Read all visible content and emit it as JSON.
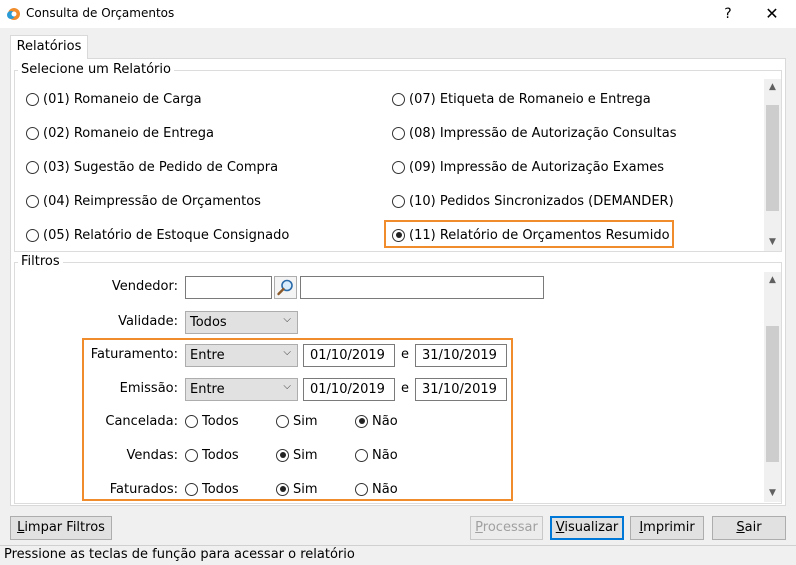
{
  "window": {
    "title": "Consulta de Orçamentos",
    "help_symbol": "?",
    "close_symbol": "✕",
    "icon": "app-logo-icon"
  },
  "tab": {
    "label": "Relatórios"
  },
  "reports": {
    "group_title": "Selecione um Relatório",
    "options": [
      "(01) Romaneio de Carga",
      "(02) Romaneio de Entrega",
      "(03) Sugestão de Pedido de Compra",
      "(04) Reimpressão de Orçamentos",
      "(05) Relatório de Estoque Consignado",
      "(07) Etiqueta de Romaneio e Entrega",
      "(08) Impressão de Autorização Consultas",
      "(09) Impressão de Autorização Exames",
      "(10) Pedidos Sincronizados (DEMANDER)",
      "(11) Relatório de Orçamentos Resumido"
    ],
    "selected": "(11) Relatório de Orçamentos Resumido"
  },
  "filters": {
    "group_title": "Filtros",
    "vendedor": {
      "label": "Vendedor:",
      "code": "",
      "name": "",
      "search_icon": "magnifier-icon"
    },
    "validade": {
      "label": "Validade:",
      "value": "Todos"
    },
    "faturamento": {
      "label": "Faturamento:",
      "mode": "Entre",
      "from": "01/10/2019",
      "sep": "e",
      "to": "31/10/2019"
    },
    "emissao": {
      "label": "Emissão:",
      "mode": "Entre",
      "from": "01/10/2019",
      "sep": "e",
      "to": "31/10/2019"
    },
    "cancelada": {
      "label": "Cancelada:",
      "opt_all": "Todos",
      "opt_yes": "Sim",
      "opt_no": "Não",
      "selected": "Não"
    },
    "vendas": {
      "label": "Vendas:",
      "opt_all": "Todos",
      "opt_yes": "Sim",
      "opt_no": "Não",
      "selected": "Sim"
    },
    "faturados": {
      "label": "Faturados:",
      "opt_all": "Todos",
      "opt_yes": "Sim",
      "opt_no": "Não",
      "selected": "Sim"
    }
  },
  "buttons": {
    "limpar": {
      "underline": "L",
      "rest": "impar Filtros"
    },
    "processar": {
      "underline": "P",
      "rest": "rocessar"
    },
    "visualizar": {
      "underline": "V",
      "rest": "isualizar"
    },
    "imprimir": {
      "underline": "I",
      "rest": "mprimir"
    },
    "sair": {
      "underline": "S",
      "rest": "air"
    }
  },
  "status": {
    "text": "Pressione as teclas de função para acessar o relatório"
  },
  "colors": {
    "highlight": "#f08c2c",
    "focus": "#0078d7"
  }
}
